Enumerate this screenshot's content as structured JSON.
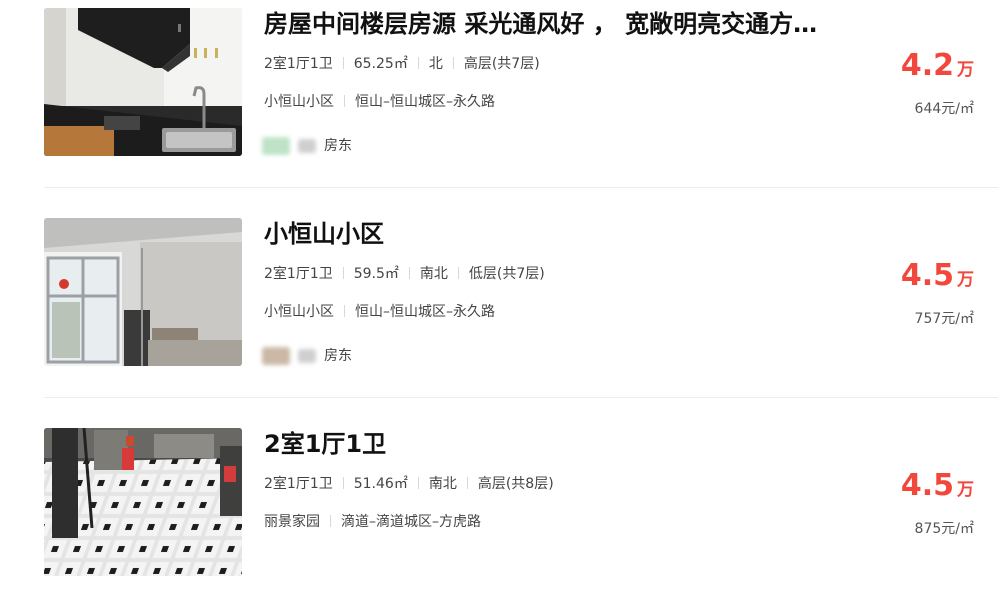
{
  "listings": [
    {
      "title": "房屋中间楼层房源 采光通风好 ， 宽敞明亮交通方…",
      "layout": "2室1厅1卫",
      "area": "65.25㎡",
      "orientation": "北",
      "floor": "高层(共7层)",
      "community": "小恒山小区",
      "district": "恒山–恒山城区–永久路",
      "owner_label": "房东",
      "price": "4.2",
      "price_unit": "万",
      "unit_price": "644元/㎡"
    },
    {
      "title": "小恒山小区",
      "layout": "2室1厅1卫",
      "area": "59.5㎡",
      "orientation": "南北",
      "floor": "低层(共7层)",
      "community": "小恒山小区",
      "district": "恒山–恒山城区–永久路",
      "owner_label": "房东",
      "price": "4.5",
      "price_unit": "万",
      "unit_price": "757元/㎡"
    },
    {
      "title": "2室1厅1卫",
      "layout": "2室1厅1卫",
      "area": "51.46㎡",
      "orientation": "南北",
      "floor": "高层(共8层)",
      "community": "丽景家园",
      "district": "滴道–滴道城区–方虎路",
      "price": "4.5",
      "price_unit": "万",
      "unit_price": "875元/㎡"
    }
  ],
  "colors": {
    "price": "#f2473c",
    "divider": "#ececec"
  },
  "thumbnail_icons": [
    "kitchen-photo",
    "empty-room-photo",
    "tiled-floor-room-photo"
  ]
}
